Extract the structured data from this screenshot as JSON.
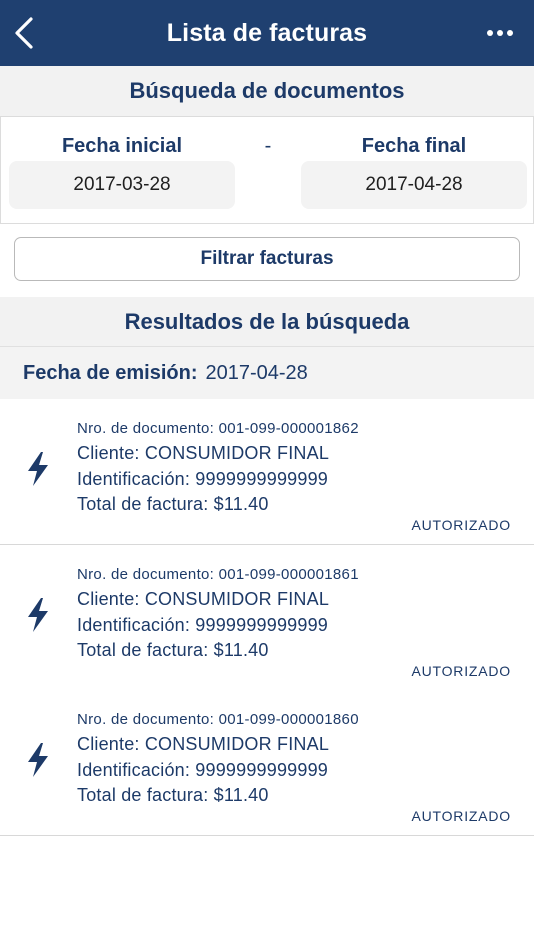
{
  "header": {
    "title": "Lista de facturas"
  },
  "search": {
    "title": "Búsqueda de documentos",
    "start_label": "Fecha inicial",
    "start_value": "2017-03-28",
    "separator": "-",
    "end_label": "Fecha final",
    "end_value": "2017-04-28",
    "filter_button": "Filtrar facturas"
  },
  "results": {
    "title": "Resultados de la búsqueda",
    "group_label": "Fecha de emisión:",
    "group_date": "2017-04-28",
    "invoices": [
      {
        "doc_number": "Nro. de documento: 001-099-000001862",
        "client": "Cliente: CONSUMIDOR FINAL",
        "identification": "Identificación: 9999999999999",
        "total": "Total de factura: $11.40",
        "status": "AUTORIZADO"
      },
      {
        "doc_number": "Nro. de documento: 001-099-000001861",
        "client": "Cliente: CONSUMIDOR FINAL",
        "identification": "Identificación: 9999999999999",
        "total": "Total de factura: $11.40",
        "status": "AUTORIZADO"
      },
      {
        "doc_number": "Nro. de documento: 001-099-000001860",
        "client": "Cliente: CONSUMIDOR FINAL",
        "identification": "Identificación: 9999999999999",
        "total": "Total de factura: $11.40",
        "status": "AUTORIZADO"
      }
    ]
  },
  "icons": {
    "back": "chevron-left-icon",
    "more": "more-horizontal-icon",
    "invoice": "lightning-bolt-icon"
  },
  "colors": {
    "navbar": "#1f4070",
    "text_primary": "#1d3a68",
    "section_background": "#f2f2f2"
  }
}
